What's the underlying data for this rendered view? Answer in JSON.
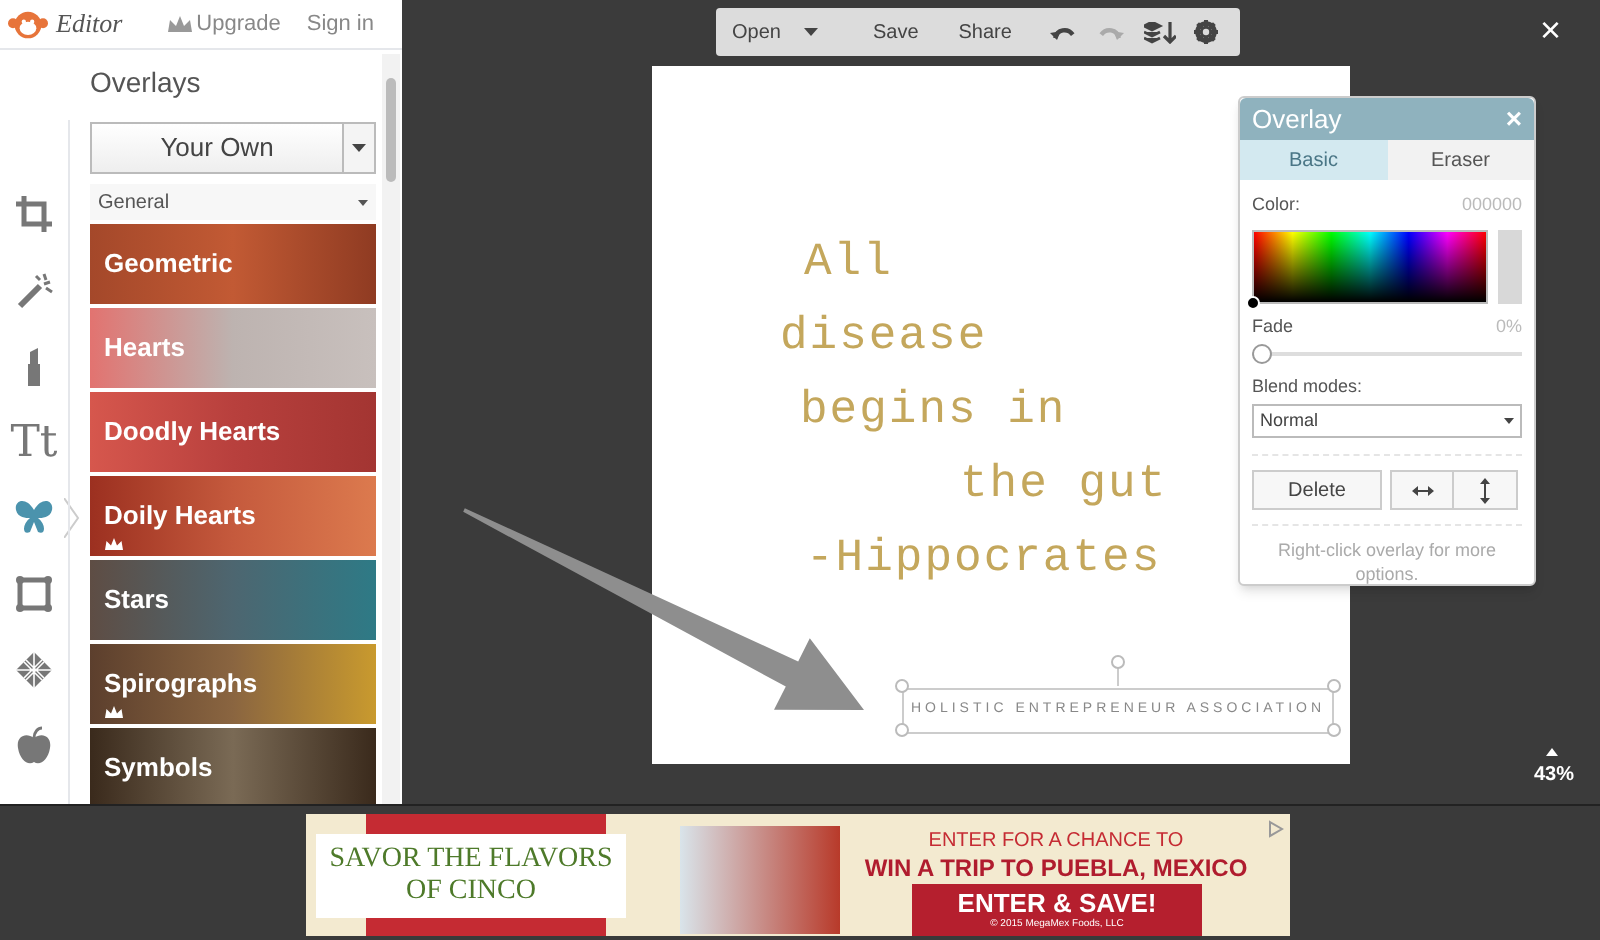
{
  "header": {
    "app_name": "Editor",
    "upgrade": "Upgrade",
    "sign_in": "Sign in"
  },
  "tools": [
    {
      "kind": "crop",
      "selected": false
    },
    {
      "kind": "wand",
      "selected": false
    },
    {
      "kind": "lipstick",
      "selected": false
    },
    {
      "kind": "text",
      "label": "Tt",
      "selected": false
    },
    {
      "kind": "butterfly",
      "selected": true
    },
    {
      "kind": "frame",
      "selected": false
    },
    {
      "kind": "texture",
      "selected": false
    },
    {
      "kind": "apple",
      "selected": false
    }
  ],
  "overlays_panel": {
    "title": "Overlays",
    "your_own": "Your Own",
    "category": "General",
    "items": [
      {
        "label": "Geometric",
        "premium": false
      },
      {
        "label": "Hearts",
        "premium": false
      },
      {
        "label": "Doodly Hearts",
        "premium": false
      },
      {
        "label": "Doily Hearts",
        "premium": true
      },
      {
        "label": "Stars",
        "premium": false
      },
      {
        "label": "Spirographs",
        "premium": true
      },
      {
        "label": "Symbols",
        "premium": false
      }
    ]
  },
  "toolbar": {
    "items": [
      {
        "kind": "menu",
        "label": "Open"
      },
      {
        "kind": "text",
        "label": "Save"
      },
      {
        "kind": "text",
        "label": "Share"
      },
      {
        "kind": "undo",
        "disabled": false
      },
      {
        "kind": "redo",
        "disabled": true
      },
      {
        "kind": "layers"
      },
      {
        "kind": "settings"
      }
    ]
  },
  "canvas": {
    "quote_lines": [
      "All",
      "disease",
      "begins in",
      "the gut",
      "-Hippocrates"
    ],
    "text_object": "HOLISTIC ENTREPRENEUR ASSOCIATION"
  },
  "overlay_dialog": {
    "title": "Overlay",
    "close": "×",
    "tabs": [
      {
        "label": "Basic",
        "selected": true
      },
      {
        "label": "Eraser",
        "selected": false
      }
    ],
    "color_label": "Color:",
    "color_value": "000000",
    "fade_label": "Fade",
    "fade_value": "0%",
    "fade": {
      "level": 0
    },
    "blend_label": "Blend modes:",
    "blend_value": "Normal",
    "delete": "Delete",
    "hint": "Right-click overlay for more options."
  },
  "close": "×",
  "zoom": "43%",
  "ad": {
    "headline": "SAVOR THE FLAVORS OF CINCO",
    "line_1": "ENTER FOR A CHANCE TO",
    "line_2": "WIN A TRIP TO PUEBLA, MEXICO",
    "cta": "ENTER & SAVE!",
    "copyright": "© 2015 MegaMex Foods, LLC"
  }
}
